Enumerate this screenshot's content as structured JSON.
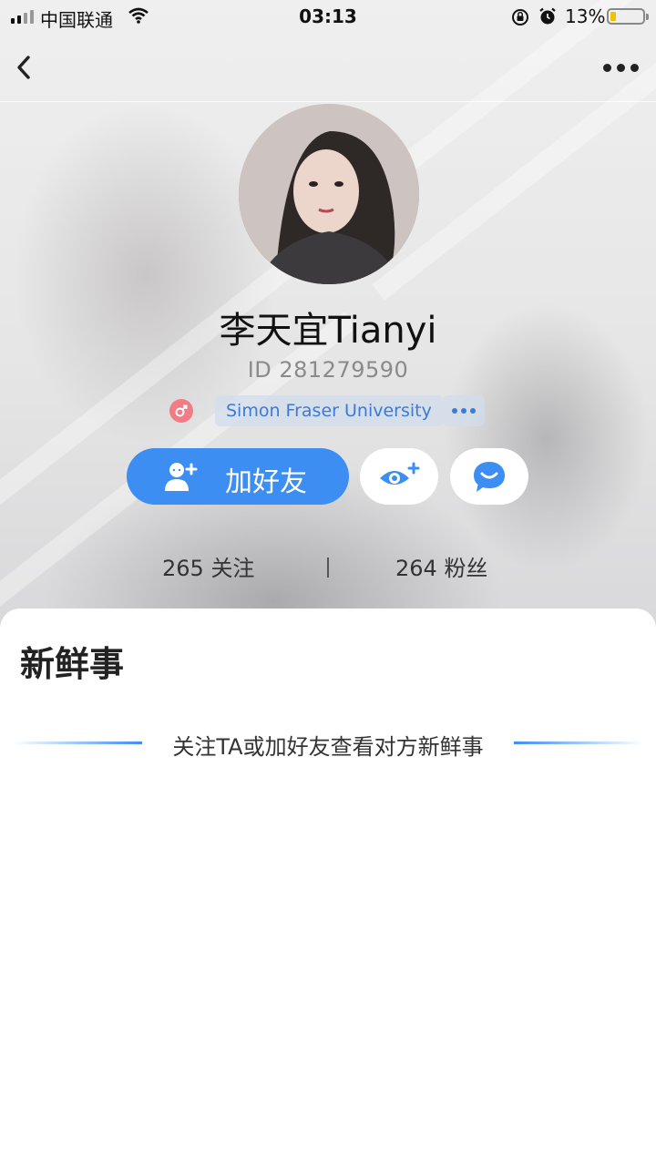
{
  "status_bar": {
    "carrier": "中国联通",
    "time": "03:13",
    "battery_percent": "13%",
    "battery_level": 0.13,
    "icons": [
      "signal-icon",
      "wifi-icon",
      "rotation-lock-icon",
      "alarm-icon",
      "battery-icon"
    ]
  },
  "nav": {
    "back_icon": "chevron-left-icon",
    "more_icon": "more-dots-icon"
  },
  "profile": {
    "name": "李天宜Tianyi",
    "id_text": "ID 281279590",
    "gender_icon": "gender-icon",
    "school": "Simon Fraser University",
    "more_tags_icon": "ellipsis-icon"
  },
  "actions": {
    "add_friend_label": "加好友",
    "add_friend_icon": "add-user-icon",
    "follow_icon": "eye-plus-icon",
    "chat_icon": "chat-bubble-icon"
  },
  "stats": {
    "following": "265 关注",
    "fans": "264 粉丝"
  },
  "feed": {
    "title": "新鲜事",
    "hint": "关注TA或加好友查看对方新鲜事"
  },
  "colors": {
    "accent": "#3c8ef3",
    "gender_badge": "#f07c86",
    "school_text": "#3a7bd5"
  }
}
